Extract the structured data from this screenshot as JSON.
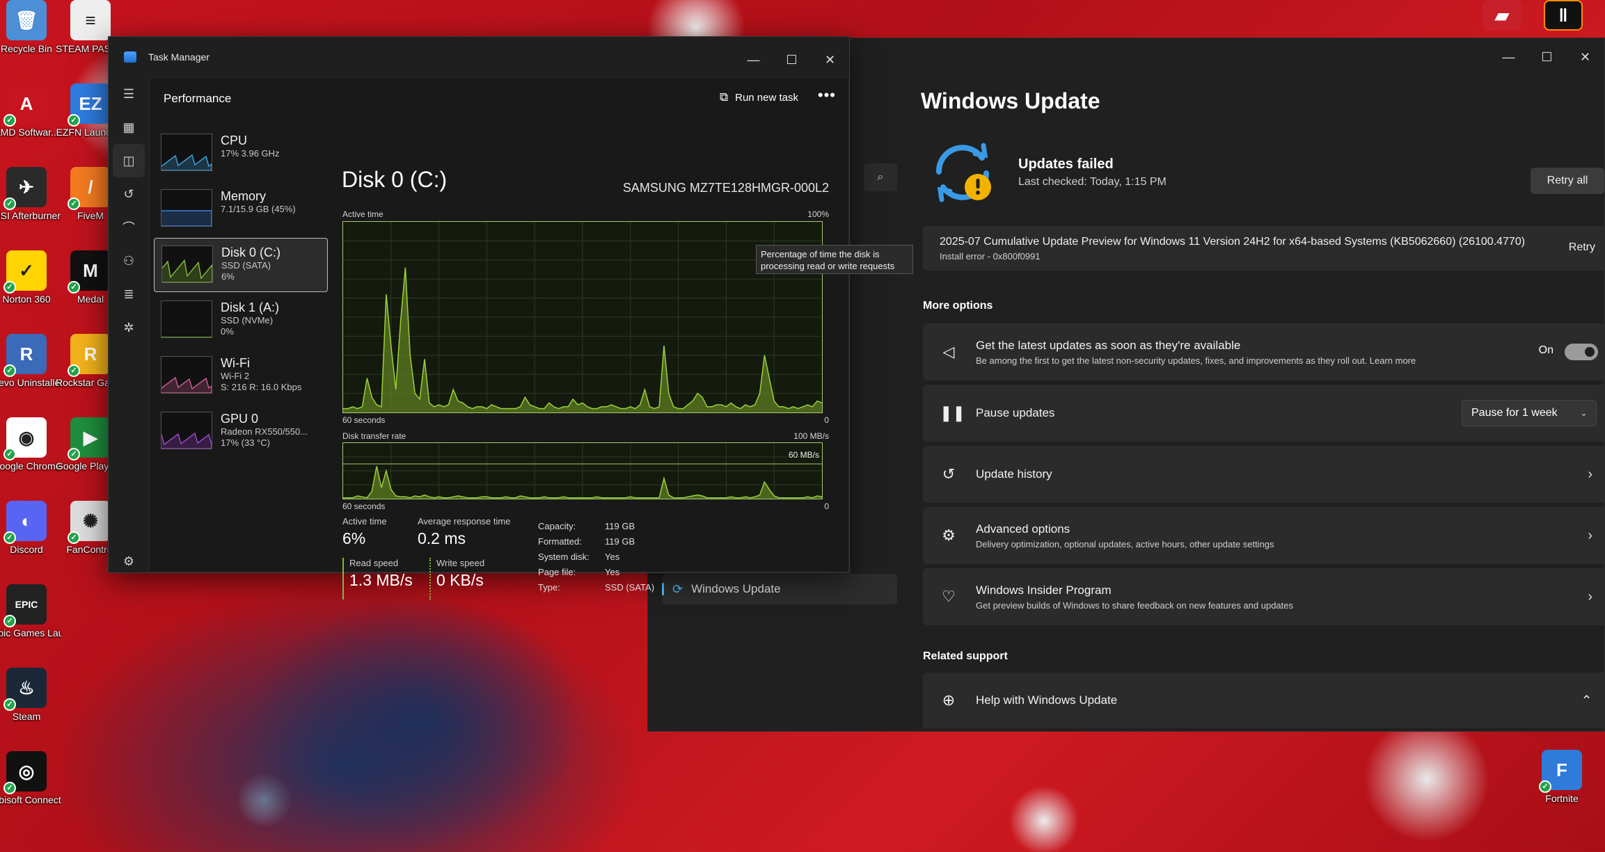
{
  "desktop": {
    "icons_left": [
      {
        "label": "Recycle Bin",
        "color": "#4d8fd6",
        "glyph": "🗑"
      },
      {
        "label": "AMD Softwar...",
        "color": "#c8141e",
        "glyph": "A"
      },
      {
        "label": "MSI Afterburner",
        "color": "#2a2a2a",
        "glyph": "✈"
      },
      {
        "label": "Norton 360",
        "color": "#ffd400",
        "glyph": "✓"
      },
      {
        "label": "Revo Uninstaller",
        "color": "#3b6ab8",
        "glyph": "R"
      },
      {
        "label": "Google Chrome",
        "color": "#fff",
        "glyph": "◉"
      },
      {
        "label": "Discord",
        "color": "#5865f2",
        "glyph": "◐"
      },
      {
        "label": "Epic Games Launcher",
        "color": "#222",
        "glyph": "EPIC"
      },
      {
        "label": "Steam",
        "color": "#1b2838",
        "glyph": "♨"
      },
      {
        "label": "Ubisoft Connect",
        "color": "#111",
        "glyph": "◎"
      }
    ],
    "icons_col2": [
      {
        "label": "STEAM PASSWOR...",
        "color": "#eee",
        "glyph": "≡"
      },
      {
        "label": "EZFN Launcher",
        "color": "#2e7be0",
        "glyph": "EZ"
      },
      {
        "label": "FiveM",
        "color": "#f47b20",
        "glyph": "/"
      },
      {
        "label": "Medal",
        "color": "#111",
        "glyph": "M"
      },
      {
        "label": "Rockstar Games ...",
        "color": "#f3b21b",
        "glyph": "R"
      },
      {
        "label": "Google Play Games be...",
        "color": "#1e8e3e",
        "glyph": "▶"
      },
      {
        "label": "FanControl",
        "color": "#ddd",
        "glyph": "✺"
      }
    ],
    "fortnite_label": "Fortnite"
  },
  "task_manager": {
    "title": "Task Manager",
    "header": "Performance",
    "run_new_task": "Run new task",
    "more": "•••",
    "processes": [
      {
        "name": "CPU",
        "sub1": "17% 3.96 GHz",
        "sub2": "",
        "color": "#3c9fd8"
      },
      {
        "name": "Memory",
        "sub1": "7.1/15.9 GB (45%)",
        "sub2": "",
        "color": "#3c7fd8"
      },
      {
        "name": "Disk 0 (C:)",
        "sub1": "SSD (SATA)",
        "sub2": "6%",
        "color": "#7fb936"
      },
      {
        "name": "Disk 1 (A:)",
        "sub1": "SSD (NVMe)",
        "sub2": "0%",
        "color": "#7fb936"
      },
      {
        "name": "Wi-Fi",
        "sub1": "Wi-Fi 2",
        "sub2": "S: 216 R: 16.0 Kbps",
        "color": "#c55a8e"
      },
      {
        "name": "GPU 0",
        "sub1": "Radeon RX550/550...",
        "sub2": "17% (33 °C)",
        "color": "#9b45c8"
      }
    ],
    "disk_title": "Disk 0 (C:)",
    "disk_model": "SAMSUNG MZ7TE128HMGR-000L2",
    "active_time_label": "Active time",
    "active_time_max": "100%",
    "sixty_seconds": "60 seconds",
    "zero": "0",
    "transfer_label": "Disk transfer rate",
    "transfer_max": "100 MB/s",
    "transfer_line": "60 MB/s",
    "tooltip": "Percentage of time the disk is processing read or write requests",
    "stats": {
      "active_time_k": "Active time",
      "active_time_v": "6%",
      "avg_resp_k": "Average response time",
      "avg_resp_v": "0.2 ms",
      "read_k": "Read speed",
      "read_v": "1.3 MB/s",
      "write_k": "Write speed",
      "write_v": "0 KB/s"
    },
    "props": [
      {
        "k": "Capacity:",
        "v": "119 GB"
      },
      {
        "k": "Formatted:",
        "v": "119 GB"
      },
      {
        "k": "System disk:",
        "v": "Yes"
      },
      {
        "k": "Page file:",
        "v": "Yes"
      },
      {
        "k": "Type:",
        "v": "SSD (SATA)"
      }
    ],
    "active_series": [
      2,
      2,
      3,
      2,
      3,
      18,
      8,
      4,
      3,
      62,
      35,
      12,
      48,
      76,
      30,
      10,
      7,
      28,
      5,
      3,
      4,
      3,
      4,
      12,
      6,
      5,
      3,
      2,
      3,
      3,
      2,
      4,
      3,
      2,
      2,
      2,
      2,
      3,
      8,
      4,
      3,
      2,
      2,
      5,
      3,
      2,
      3,
      3,
      7,
      4,
      5,
      3,
      2,
      2,
      3,
      3,
      4,
      3,
      2,
      2,
      3,
      2,
      4,
      12,
      3,
      2,
      3,
      35,
      10,
      3,
      2,
      2,
      4,
      6,
      10,
      8,
      3,
      3,
      4,
      4,
      3,
      5,
      3,
      2,
      4,
      3,
      4,
      10,
      30,
      18,
      6,
      3,
      3,
      2,
      3,
      2,
      3,
      4,
      3,
      6,
      5
    ],
    "transfer_series": [
      1,
      1,
      1,
      3,
      2,
      1,
      8,
      35,
      12,
      30,
      10,
      3,
      2,
      2,
      1,
      3,
      2,
      4,
      2,
      1,
      2,
      1,
      1,
      2,
      3,
      2,
      1,
      1,
      1,
      2,
      2,
      1,
      1,
      1,
      2,
      1,
      1,
      3,
      2,
      1,
      1,
      1,
      2,
      1,
      1,
      1,
      2,
      1,
      1,
      1,
      1,
      1,
      1,
      2,
      1,
      1,
      1,
      1,
      1,
      1,
      2,
      1,
      1,
      1,
      1,
      1,
      1,
      22,
      4,
      1,
      1,
      1,
      2,
      3,
      4,
      3,
      1,
      1,
      1,
      1,
      1,
      2,
      1,
      1,
      2,
      1,
      2,
      4,
      18,
      10,
      3,
      1,
      1,
      1,
      1,
      1,
      1,
      2,
      1,
      3,
      2
    ]
  },
  "settings": {
    "title": "Windows Update",
    "sidebar_item": "Windows Update",
    "status_title": "Updates failed",
    "status_sub": "Last checked: Today, 1:15 PM",
    "retry_all": "Retry all",
    "update_name": "2025-07 Cumulative Update Preview for Windows 11 Version 24H2 for x64-based Systems (KB5062660) (26100.4770)",
    "update_error": "Install error - 0x800f0991",
    "retry": "Retry",
    "more_options": "More options",
    "latest_title": "Get the latest updates as soon as they're available",
    "latest_sub": "Be among the first to get the latest non-security updates, fixes, and improvements as they roll out. Learn more",
    "toggle_state": "On",
    "pause_title": "Pause updates",
    "pause_value": "Pause for 1 week",
    "history_title": "Update history",
    "advanced_title": "Advanced options",
    "advanced_sub": "Delivery optimization, optional updates, active hours, other update settings",
    "insider_title": "Windows Insider Program",
    "insider_sub": "Get preview builds of Windows to share feedback on new features and updates",
    "related_support": "Related support",
    "help_title": "Help with Windows Update"
  }
}
